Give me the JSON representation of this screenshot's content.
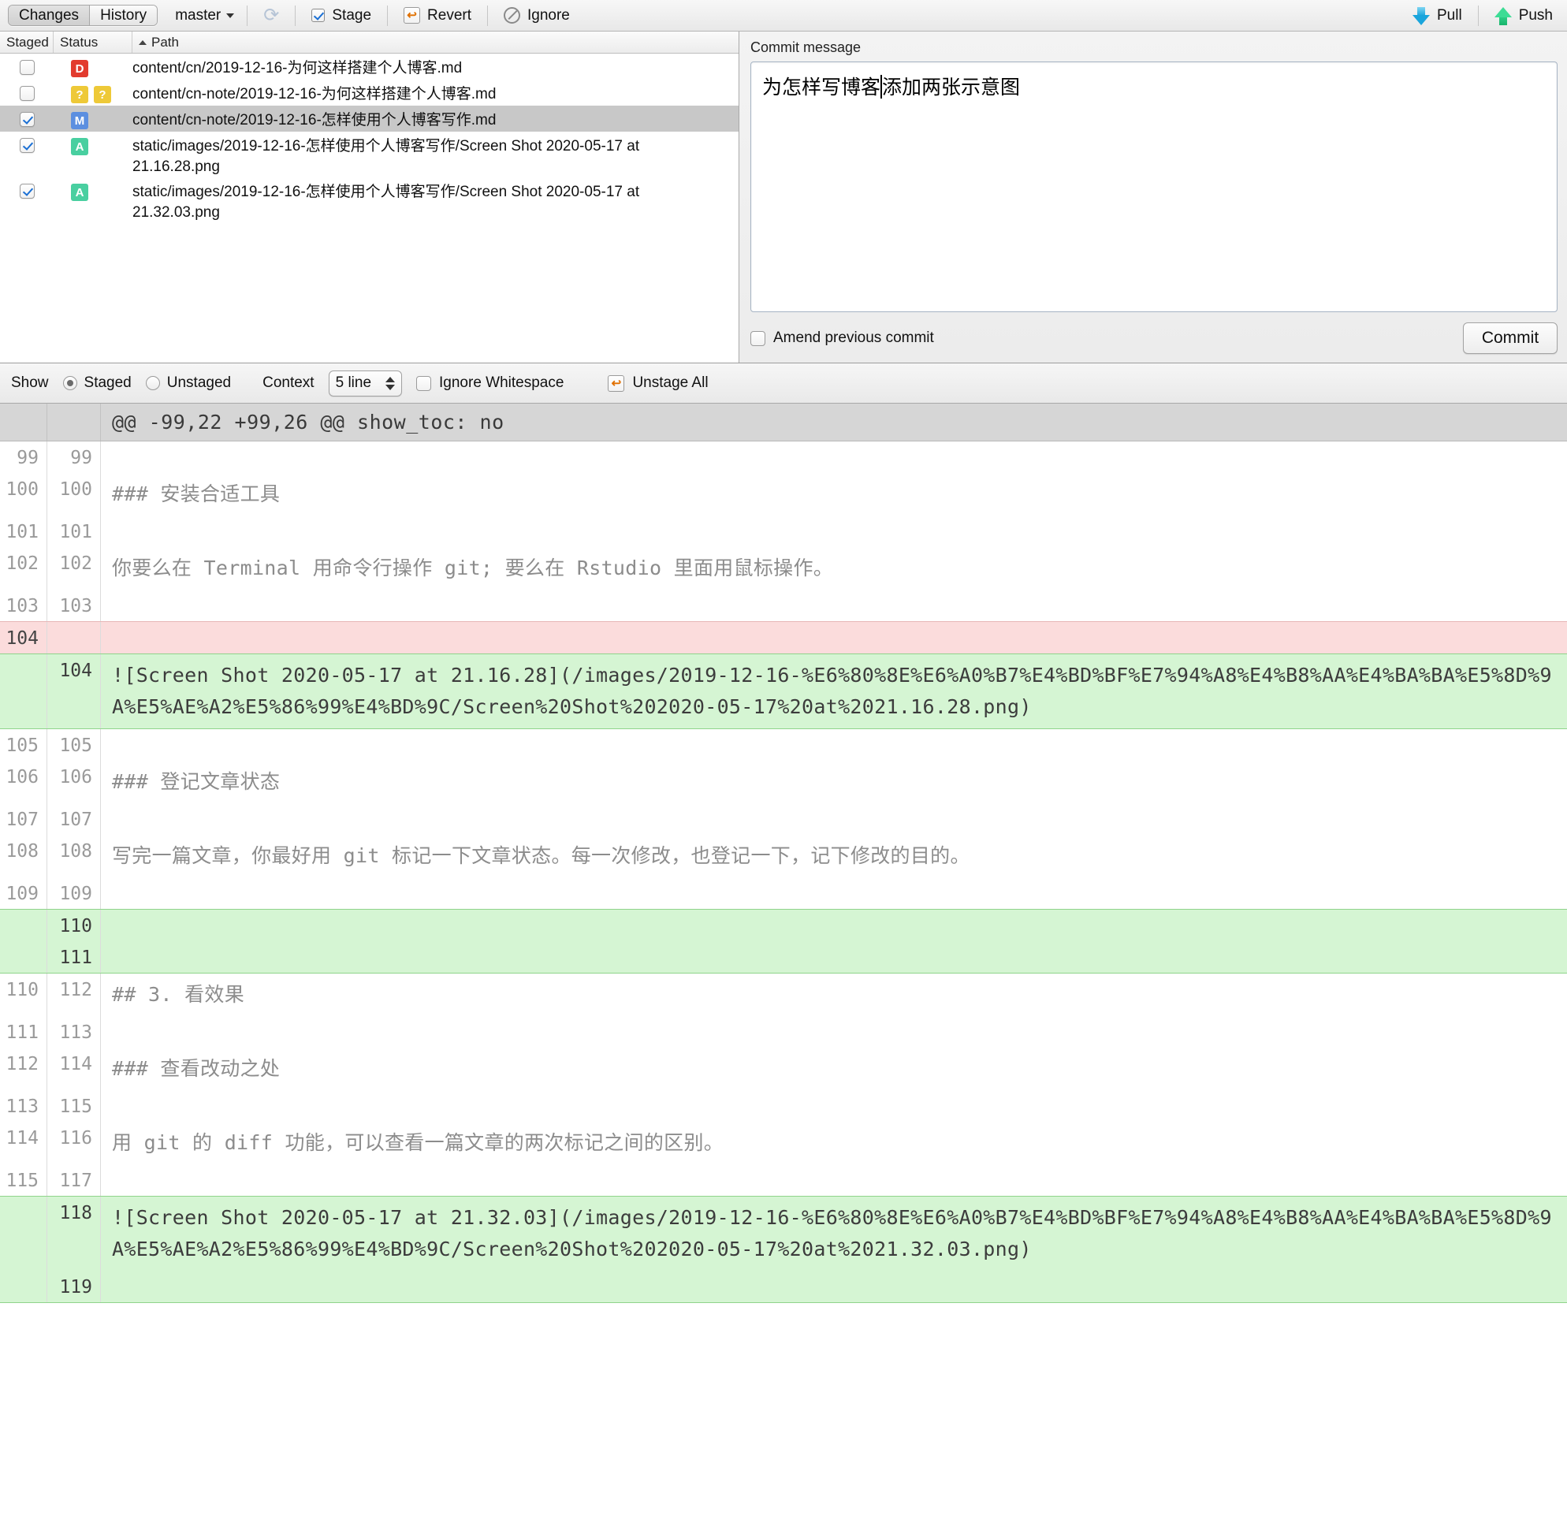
{
  "toolbar": {
    "tabs": [
      {
        "label": "Changes",
        "active": true
      },
      {
        "label": "History",
        "active": false
      }
    ],
    "branch": "master",
    "refresh_icon": "refresh-icon",
    "stage_label": "Stage",
    "revert_label": "Revert",
    "ignore_label": "Ignore",
    "pull_label": "Pull",
    "push_label": "Push"
  },
  "filelist": {
    "columns": {
      "staged": "Staged",
      "status": "Status",
      "path": "Path"
    },
    "sort_indicator": "ascending",
    "rows": [
      {
        "staged": false,
        "badges": [
          "D"
        ],
        "path": "content/cn/2019-12-16-为何这样搭建个人博客.md",
        "selected": false
      },
      {
        "staged": false,
        "badges": [
          "?",
          "?"
        ],
        "path": "content/cn-note/2019-12-16-为何这样搭建个人博客.md",
        "selected": false
      },
      {
        "staged": true,
        "badges": [
          "M"
        ],
        "path": "content/cn-note/2019-12-16-怎样使用个人博客写作.md",
        "selected": true
      },
      {
        "staged": true,
        "badges": [
          "A"
        ],
        "path": "static/images/2019-12-16-怎样使用个人博客写作/Screen Shot 2020-05-17 at 21.16.28.png",
        "selected": false
      },
      {
        "staged": true,
        "badges": [
          "A"
        ],
        "path": "static/images/2019-12-16-怎样使用个人博客写作/Screen Shot 2020-05-17 at 21.32.03.png",
        "selected": false
      }
    ]
  },
  "commit": {
    "label": "Commit message",
    "message_before_caret": "为怎样写博客",
    "message_after_caret": "添加两张示意图",
    "amend_label": "Amend previous commit",
    "amend_checked": false,
    "button_label": "Commit"
  },
  "showbar": {
    "show_label": "Show",
    "staged_label": "Staged",
    "unstaged_label": "Unstaged",
    "staged_selected": true,
    "context_label": "Context",
    "context_value": "5 line",
    "ignore_ws_label": "Ignore Whitespace",
    "ignore_ws_checked": false,
    "unstage_all_label": "Unstage All",
    "revert_icon": "revert-arrow-icon"
  },
  "diff": {
    "hunk_header": "@@ -99,22 +99,26 @@ show_toc: no",
    "lines": [
      {
        "old": "99",
        "new": "99",
        "type": "ctx",
        "text": ""
      },
      {
        "old": "100",
        "new": "100",
        "type": "ctx",
        "text": "### 安装合适工具"
      },
      {
        "old": "101",
        "new": "101",
        "type": "ctx",
        "text": ""
      },
      {
        "old": "102",
        "new": "102",
        "type": "ctx",
        "text": "你要么在 Terminal 用命令行操作 git; 要么在 Rstudio 里面用鼠标操作。"
      },
      {
        "old": "103",
        "new": "103",
        "type": "ctx",
        "text": ""
      },
      {
        "old": "104",
        "new": "",
        "type": "del",
        "text": ""
      },
      {
        "old": "",
        "new": "104",
        "type": "add",
        "text": "![Screen Shot 2020-05-17 at 21.16.28](/images/2019-12-16-%E6%80%8E%E6%A0%B7%E4%BD%BF%E7%94%A8%E4%B8%AA%E4%BA%BA%E5%8D%9A%E5%AE%A2%E5%86%99%E4%BD%9C/Screen%20Shot%202020-05-17%20at%2021.16.28.png)"
      },
      {
        "old": "105",
        "new": "105",
        "type": "ctx",
        "text": ""
      },
      {
        "old": "106",
        "new": "106",
        "type": "ctx",
        "text": "### 登记文章状态"
      },
      {
        "old": "107",
        "new": "107",
        "type": "ctx",
        "text": ""
      },
      {
        "old": "108",
        "new": "108",
        "type": "ctx",
        "text": "写完一篇文章，你最好用 git 标记一下文章状态。每一次修改，也登记一下，记下修改的目的。"
      },
      {
        "old": "109",
        "new": "109",
        "type": "ctx",
        "text": ""
      },
      {
        "old": "",
        "new": "110",
        "type": "add",
        "text": ""
      },
      {
        "old": "",
        "new": "111",
        "type": "add",
        "text": ""
      },
      {
        "old": "110",
        "new": "112",
        "type": "ctx",
        "text": "## 3. 看效果"
      },
      {
        "old": "111",
        "new": "113",
        "type": "ctx",
        "text": ""
      },
      {
        "old": "112",
        "new": "114",
        "type": "ctx",
        "text": "### 查看改动之处"
      },
      {
        "old": "113",
        "new": "115",
        "type": "ctx",
        "text": ""
      },
      {
        "old": "114",
        "new": "116",
        "type": "ctx",
        "text": "用 git 的 diff 功能，可以查看一篇文章的两次标记之间的区别。"
      },
      {
        "old": "115",
        "new": "117",
        "type": "ctx",
        "text": ""
      },
      {
        "old": "",
        "new": "118",
        "type": "add",
        "text": "![Screen Shot 2020-05-17 at 21.32.03](/images/2019-12-16-%E6%80%8E%E6%A0%B7%E4%BD%BF%E7%94%A8%E4%B8%AA%E4%BA%BA%E5%8D%9A%E5%AE%A2%E5%86%99%E4%BD%9C/Screen%20Shot%202020-05-17%20at%2021.32.03.png)"
      },
      {
        "old": "",
        "new": "119",
        "type": "add",
        "text": ""
      }
    ]
  }
}
